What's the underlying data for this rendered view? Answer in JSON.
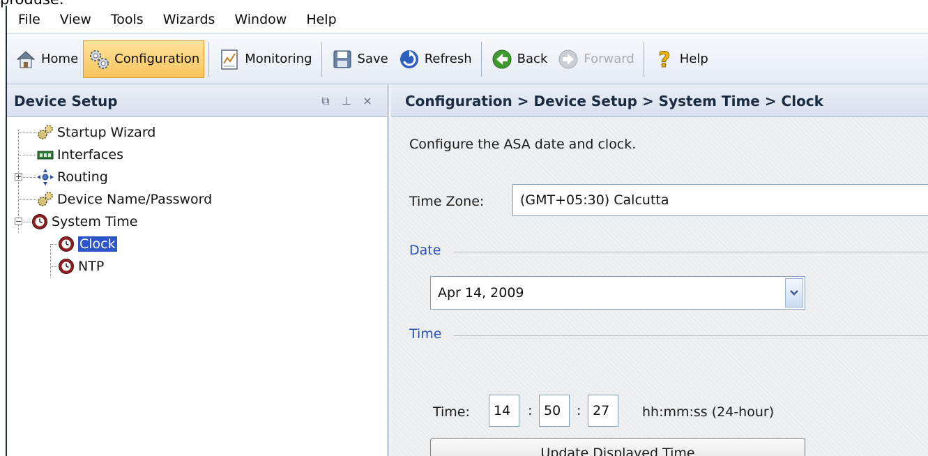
{
  "page_fragment_text": "produse.",
  "menu": [
    "File",
    "View",
    "Tools",
    "Wizards",
    "Window",
    "Help"
  ],
  "toolbar": {
    "home": "Home",
    "configuration": "Configuration",
    "monitoring": "Monitoring",
    "save": "Save",
    "refresh": "Refresh",
    "back": "Back",
    "forward": "Forward",
    "help": "Help"
  },
  "left_pane": {
    "title": "Device Setup",
    "controls": {
      "restore": "⧉",
      "pin": "⊥",
      "close": "×"
    },
    "tree": [
      {
        "label": "Startup Wizard",
        "icon": "gears-icon"
      },
      {
        "label": "Interfaces",
        "icon": "interfaces-icon"
      },
      {
        "label": "Routing",
        "icon": "routing-icon",
        "expander": "+"
      },
      {
        "label": "Device Name/Password",
        "icon": "gears-icon"
      },
      {
        "label": "System Time",
        "icon": "clock-icon",
        "expander": "−"
      },
      {
        "label": "Clock",
        "icon": "clock-icon",
        "selected": true
      },
      {
        "label": "NTP",
        "icon": "clock-icon"
      }
    ]
  },
  "right_pane": {
    "breadcrumb": "Configuration > Device Setup > System Time > Clock",
    "description": "Configure the ASA date and clock.",
    "time_zone_label": "Time Zone:",
    "time_zone_value": "(GMT+05:30) Calcutta",
    "date_group_label": "Date",
    "date_value": "Apr 14, 2009",
    "time_group_label": "Time",
    "time_label": "Time:",
    "hours": "14",
    "minutes": "50",
    "seconds": "27",
    "colon": ":",
    "time_format_hint": "hh:mm:ss (24-hour)",
    "update_button": "Update Displayed Time"
  },
  "colors": {
    "accent_blue": "#2850b8",
    "selection": "#2b55c8",
    "active_tool": "#f7c35d"
  }
}
